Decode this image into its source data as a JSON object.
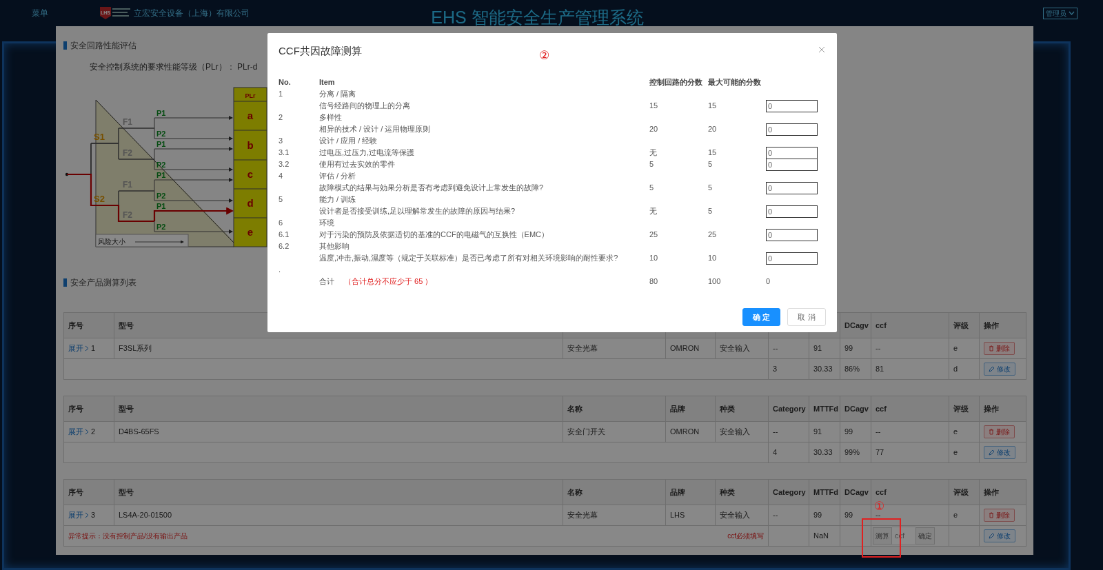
{
  "header": {
    "menu": "菜单",
    "logo": "LHS",
    "company": "立宏安全设备（上海）有限公司",
    "title": "EHS 智能安全生产管理系统",
    "user": "管理员"
  },
  "assessment": {
    "title": "安全回路性能评估",
    "plr_text": "安全控制系统的要求性能等级（PLr）： PLr-d",
    "risk_graph": {
      "header": "PLr",
      "levels": [
        "a",
        "b",
        "c",
        "d",
        "e"
      ],
      "severity": [
        "S1",
        "S2"
      ],
      "frequency": [
        "F1",
        "F2",
        "F1",
        "F2"
      ],
      "possibility": [
        {
          "label": "P1",
          "selected": false
        },
        {
          "label": "P2",
          "selected": false
        },
        {
          "label": "P1",
          "selected": false
        },
        {
          "label": "P2",
          "selected": false
        },
        {
          "label": "P1",
          "selected": false
        },
        {
          "label": "P2",
          "selected": false
        },
        {
          "label": "P1",
          "selected": true
        },
        {
          "label": "P2",
          "selected": false
        }
      ],
      "axis_label": "风险大小"
    }
  },
  "product_list": {
    "title": "安全产品测算列表",
    "tables": [
      {
        "header_left": [
          "序号",
          "型号"
        ],
        "header_right": [
          "DCagv",
          "ccf",
          "评级",
          "操作"
        ],
        "rows": [
          {
            "kind": "item",
            "expand": "展开",
            "index": "1",
            "model": "F3SL系列",
            "name": "安全光幕",
            "brand": "OMRON",
            "type": "安全输入",
            "category": "--",
            "mttfd": "91",
            "dcavg": "99",
            "ccf": "--",
            "grade": "e",
            "action": "删除"
          },
          {
            "kind": "summary",
            "category": "3",
            "mttfd": "30.33",
            "dcavg": "86%",
            "ccf": "81",
            "grade": "d",
            "action": "修改"
          }
        ]
      },
      {
        "header": [
          "序号",
          "型号",
          "名称",
          "品牌",
          "种类",
          "Category",
          "MTTFd",
          "DCagv",
          "ccf",
          "评级",
          "操作"
        ],
        "rows": [
          {
            "kind": "item",
            "expand": "展开",
            "index": "2",
            "model": "D4BS-65FS",
            "name": "安全门开关",
            "brand": "OMRON",
            "type": "安全输入",
            "category": "--",
            "mttfd": "91",
            "dcavg": "99",
            "ccf": "--",
            "grade": "e",
            "action": "删除"
          },
          {
            "kind": "summary",
            "category": "4",
            "mttfd": "30.33",
            "dcavg": "99%",
            "ccf": "77",
            "grade": "e",
            "action": "修改"
          }
        ]
      },
      {
        "header": [
          "序号",
          "型号",
          "名称",
          "品牌",
          "种类",
          "Category",
          "MTTFd",
          "DCagv",
          "ccf",
          "评级",
          "操作"
        ],
        "rows": [
          {
            "kind": "item",
            "expand": "展开",
            "index": "3",
            "model": "LS4A-20-01500",
            "name": "安全光幕",
            "brand": "LHS",
            "type": "安全输入",
            "category": "--",
            "mttfd": "99",
            "dcavg": "99",
            "ccf": "--",
            "grade": "e",
            "action": "删除"
          },
          {
            "kind": "summary",
            "warning": "异常提示：没有控制产品/没有输出产品",
            "notice": "ccf必须填写",
            "mttfd": "NaN",
            "ccf_tool": {
              "button": "测算",
              "placeholder": "ccf",
              "confirm": "确定"
            },
            "action": "修改"
          }
        ]
      }
    ]
  },
  "dialog": {
    "title": "CCF共因故障测算",
    "columns": [
      "No.",
      "Item",
      "控制回路的分数",
      "最大可能的分数"
    ],
    "rows": [
      {
        "no": "1",
        "item": "分离 / 隔离"
      },
      {
        "item": "信号经路间的物理上的分离",
        "score": "15",
        "max": "15",
        "value": "0"
      },
      {
        "no": "2",
        "item": "多样性"
      },
      {
        "item": "相异的技术 / 设计 / 运用物理原则",
        "score": "20",
        "max": "20",
        "value": "0"
      },
      {
        "no": "3",
        "item": "设计 / 应用 / 经験"
      },
      {
        "no": "3.1",
        "item": "过电压,过压力,过电流等保護",
        "score": "无",
        "max": "15",
        "value": "0"
      },
      {
        "no": "3.2",
        "item": "使用有过去实效的零件",
        "score": "5",
        "max": "5",
        "value": "0"
      },
      {
        "no": "4",
        "item": "评估 / 分析"
      },
      {
        "item": "故障模式的结果与効果分析是否有考虑到避免设计上常发生的故障?",
        "score": "5",
        "max": "5",
        "value": "0"
      },
      {
        "no": "5",
        "item": "能力 / 训练"
      },
      {
        "item": "设计者是否接受训练,足以理解常发生的故障的原因与结果?",
        "score": "无",
        "max": "5",
        "value": "0"
      },
      {
        "no": "6",
        "item": "环境"
      },
      {
        "no": "6.1",
        "item": "对于污染的预防及依据适切的基准的CCF的电磁气的互换性（EMC）",
        "score": "25",
        "max": "25",
        "value": "0"
      },
      {
        "no": "6.2",
        "item": "其他影响"
      },
      {
        "item": "温度,冲击,振动,濕度等（规定于关联标准）是否已考虑了所有对相关环境影响的耐性要求?",
        "score": "10",
        "max": "10",
        "value": "0"
      },
      {
        "no": "."
      }
    ],
    "total": {
      "label": "合计",
      "note": "（合计总分不应少于 65 ）",
      "score": "80",
      "max": "100",
      "sum": "0"
    },
    "buttons": [
      {
        "label": "确 定",
        "kind": "primary"
      },
      {
        "label": "取 消",
        "kind": "default"
      }
    ]
  },
  "annotations": {
    "dialog_marker": "②",
    "cell_marker": "①"
  }
}
